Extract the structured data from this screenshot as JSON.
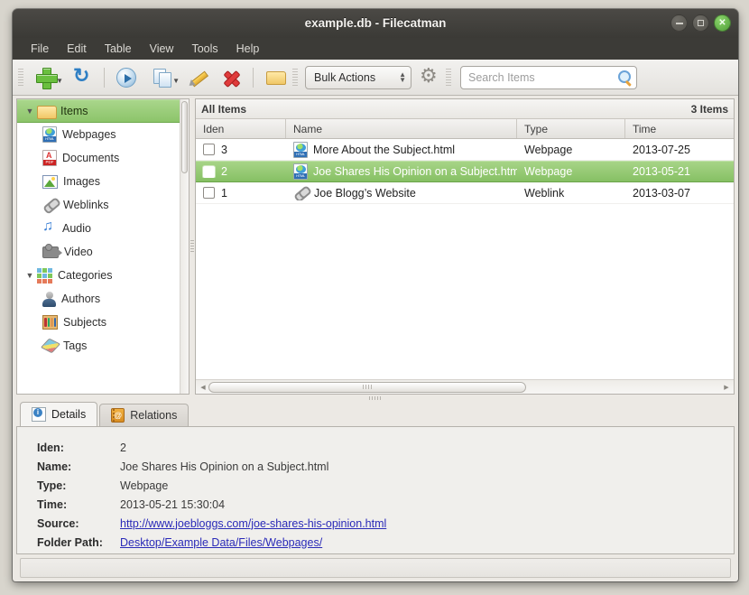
{
  "window": {
    "title": "example.db - Filecatman",
    "controls": [
      {
        "name": "minimize",
        "label": "–"
      },
      {
        "name": "maximize",
        "label": "□"
      },
      {
        "name": "close",
        "label": "✕"
      }
    ]
  },
  "menubar": {
    "items": [
      "File",
      "Edit",
      "Table",
      "View",
      "Tools",
      "Help"
    ]
  },
  "toolbar": {
    "buttons": [
      {
        "name": "add-item-button",
        "icon": "plus-icon",
        "caret": true
      },
      {
        "name": "refresh-button",
        "icon": "refresh-icon",
        "caret": false
      },
      {
        "name": "open-item-button",
        "icon": "play-icon",
        "caret": false
      },
      {
        "name": "duplicate-item-button",
        "icon": "copy-icon",
        "caret": true
      },
      {
        "name": "edit-item-button",
        "icon": "pencil-icon",
        "caret": false
      },
      {
        "name": "delete-item-button",
        "icon": "delete-x-icon",
        "caret": false
      },
      {
        "name": "open-folder-button",
        "icon": "folder-icon",
        "caret": false
      }
    ],
    "bulk_actions": {
      "label": "Bulk Actions",
      "name": "bulk-actions-combo"
    },
    "settings": {
      "name": "settings-gear-button",
      "icon": "gear-icon"
    },
    "search": {
      "placeholder": "Search Items",
      "value": "",
      "icon": "search-icon"
    }
  },
  "sidebar": {
    "nodes": [
      {
        "label": "Items",
        "icon": "folder-open-icon",
        "level": 0,
        "expander": "▼",
        "selected": true
      },
      {
        "label": "Webpages",
        "icon": "html-document-icon",
        "level": 1,
        "selected": false
      },
      {
        "label": "Documents",
        "icon": "pdf-document-icon",
        "level": 1,
        "selected": false
      },
      {
        "label": "Images",
        "icon": "image-icon",
        "level": 1,
        "selected": false
      },
      {
        "label": "Weblinks",
        "icon": "link-icon",
        "level": 1,
        "selected": false
      },
      {
        "label": "Audio",
        "icon": "audio-note-icon",
        "level": 1,
        "selected": false
      },
      {
        "label": "Video",
        "icon": "video-camera-icon",
        "level": 1,
        "selected": false
      },
      {
        "label": "Categories",
        "icon": "categories-grid-icon",
        "level": 0,
        "expander": "▼",
        "selected": false
      },
      {
        "label": "Authors",
        "icon": "author-person-icon",
        "level": 1,
        "selected": false
      },
      {
        "label": "Subjects",
        "icon": "bookshelf-icon",
        "level": 1,
        "selected": false
      },
      {
        "label": "Tags",
        "icon": "tags-icon",
        "level": 1,
        "selected": false
      }
    ]
  },
  "table": {
    "heading": "All Items",
    "count_label": "3 Items",
    "columns": [
      "Iden",
      "Name",
      "Type",
      "Time"
    ],
    "rows": [
      {
        "iden": "3",
        "name": "More About the Subject.html",
        "type": "Webpage",
        "time": "2013-07-25",
        "icon": "html-document-icon",
        "checked": false,
        "selected": false
      },
      {
        "iden": "2",
        "name": "Joe Shares His Opinion on a Subject.html",
        "type": "Webpage",
        "time": "2013-05-21",
        "icon": "html-document-icon",
        "checked": false,
        "selected": true
      },
      {
        "iden": "1",
        "name": "Joe Blogg’s Website",
        "type": "Weblink",
        "time": "2013-03-07",
        "icon": "link-icon",
        "checked": false,
        "selected": false
      }
    ]
  },
  "details": {
    "tabs": [
      {
        "label": "Details",
        "icon": "details-info-icon",
        "active": true
      },
      {
        "label": "Relations",
        "icon": "relations-book-icon",
        "active": false
      }
    ],
    "fields": [
      {
        "label": "Iden:",
        "value": "2",
        "link": false
      },
      {
        "label": "Name:",
        "value": "Joe Shares His Opinion on a Subject.html",
        "link": false
      },
      {
        "label": "Type:",
        "value": "Webpage",
        "link": false
      },
      {
        "label": "Time:",
        "value": "2013-05-21 15:30:04",
        "link": false
      },
      {
        "label": "Source:",
        "value": "http://www.joebloggs.com/joe-shares-his-opinion.html",
        "link": true
      },
      {
        "label": "Folder Path:",
        "value": "Desktop/Example Data/Files/Webpages/",
        "link": true
      }
    ]
  },
  "statusbar": {
    "text": ""
  },
  "colors": {
    "titlebar": "#3c3b37",
    "selection_green": "#8cc46a",
    "link": "#2a2ab8",
    "toolbar": "#ebe9e5"
  }
}
